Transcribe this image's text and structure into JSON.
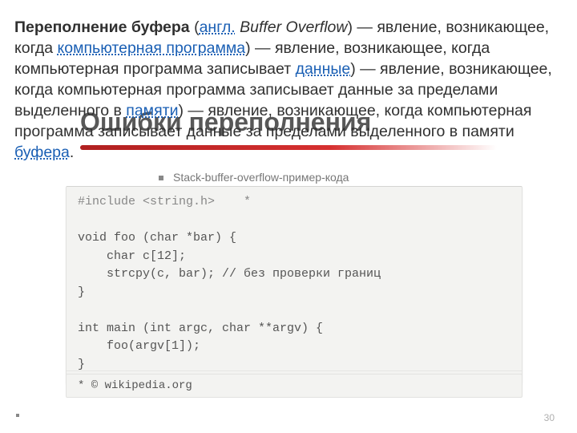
{
  "slide": {
    "title": "Ошибки переполнения",
    "hint": "Stack-buffer-overflow-пример-кода",
    "attribution": "* © wikipedia.org",
    "page_number": "30"
  },
  "code": {
    "l1": "#include <string.h>    *",
    "l2": "",
    "l3": "void foo (char *bar) {",
    "l4": "    char c[12];",
    "l5": "    strcpy(c, bar); // без проверки границ",
    "l6": "}",
    "l7": "",
    "l8": "int main (int argc, char **argv) {",
    "l9": "    foo(argv[1]);",
    "l10": "}"
  },
  "paragraph": {
    "term": "Переполнение буфера",
    "open_paren": " (",
    "lang_link": "англ.",
    "space_italic_open": " ",
    "english_term": "Buffer Overflow",
    "close_paren_seg1": ") — явление, возникающее, когда ",
    "link_program": "компьютерная программа",
    "seg2": ") — явление, возникающее, когда компьютерная программа записывает ",
    "link_data": "данные",
    "seg3": ") — явление, возникающее, когда компьютерная программа записывает данные за пределами выделенного в ",
    "link_memory": "памяти",
    "seg4": ") — явление, возникающее, когда компьютерная программа записывает данные за пределами выделенного в памяти ",
    "link_buffer": "буфера",
    "period": "."
  }
}
